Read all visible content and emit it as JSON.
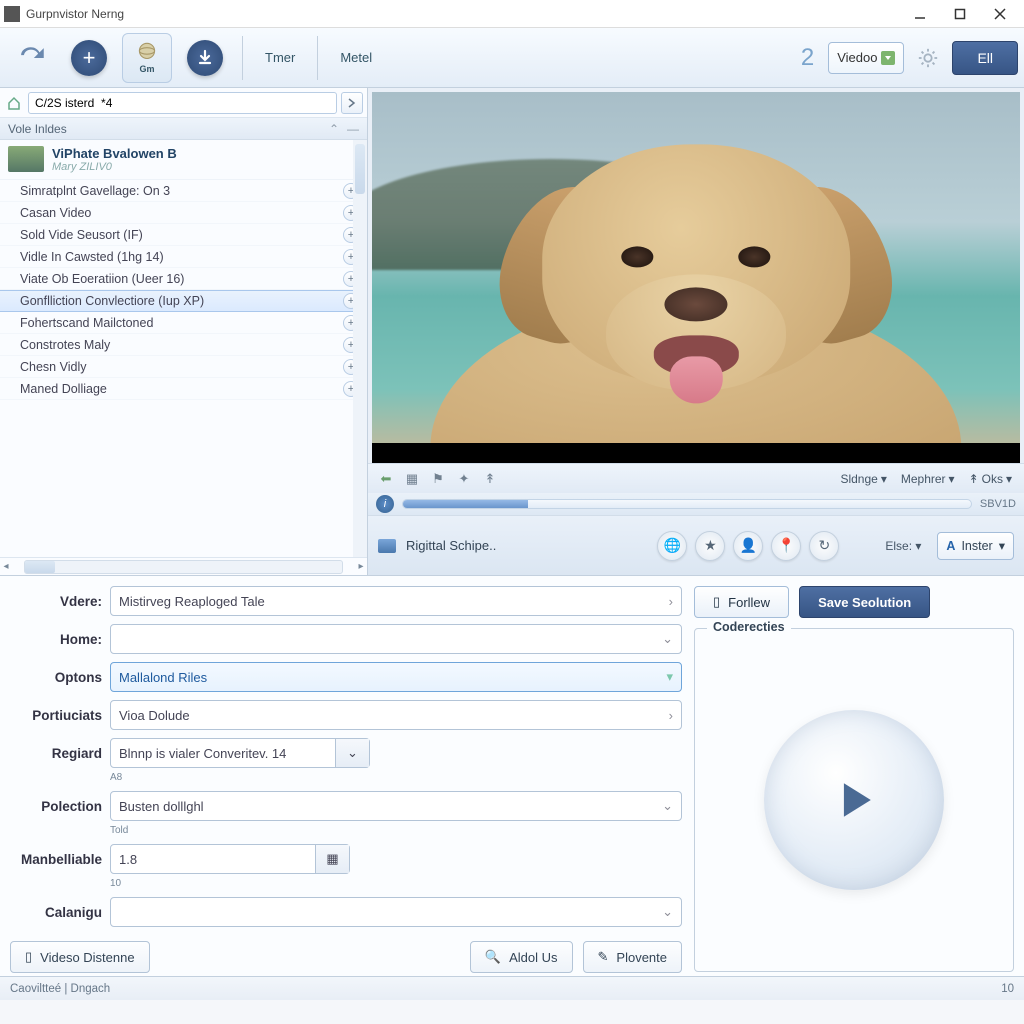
{
  "window": {
    "title": "Gurpnvistor Nerng"
  },
  "toolbar": {
    "gm_label": "Gm",
    "timer": "Tmer",
    "metel": "Metel",
    "step": "2",
    "video_combo": "Viedoo",
    "primary": "Ell"
  },
  "sidebar": {
    "path": "C/2S isterd  *4",
    "panel_title": "Vole Inldes",
    "featured": {
      "title": "ViPhate Bvalowen B",
      "subtitle": "Mary ZILIV0"
    },
    "items": [
      "Simratplnt Gavellage:  On 3",
      "Casan Video",
      "Sold Vide Seusort (IF)",
      "Vidle In Cawsted (1hg 14)",
      "Viate Ob Eoeratiion (Ueer 16)",
      "Gonflliction Convlectiore (Iup XP)",
      "Fohertscand Mailctoned",
      "Constrotes Maly",
      "Chesn Vidly",
      "Maned Dolliage"
    ],
    "selected_index": 5
  },
  "preview": {
    "toolbar": {
      "slange": "Sldnge",
      "mepher": "Mephrer",
      "oks": "Oks"
    },
    "progress_time": "SBV1D",
    "actions": {
      "label": "Rigittal Schipe..",
      "else": "Else:",
      "inster": "Inster"
    }
  },
  "form": {
    "labels": {
      "vdere": "Vdere:",
      "home": "Home:",
      "options": "Optons",
      "portiuciats": "Portiuciats",
      "regiard": "Regiard",
      "polection": "Polection",
      "manbelliable": "Manbelliable",
      "calanigu": "Calanigu"
    },
    "values": {
      "vdere": "Mistirveg Reaploged Tale",
      "home": "",
      "options": "Mallalond Riles",
      "portiuciats": "Vioa Dolude",
      "regiard": "Blnnp is vialer Converitev. 14",
      "polection_hint": "A8",
      "polection": "Busten dolllghl",
      "manbelliable_hint": "Told",
      "manbelliable": "1.8",
      "calanigu_hint": "10",
      "calanigu": ""
    },
    "buttons": {
      "video_distenne": "Videso Distenne",
      "aldol_us": "Aldol Us",
      "plovente": "Plovente",
      "forllew": "Forllew",
      "save": "Save Seolution",
      "coderecties": "Coderecties"
    }
  },
  "status": {
    "left": "Caoviltteé | Dngach",
    "right": "10"
  }
}
